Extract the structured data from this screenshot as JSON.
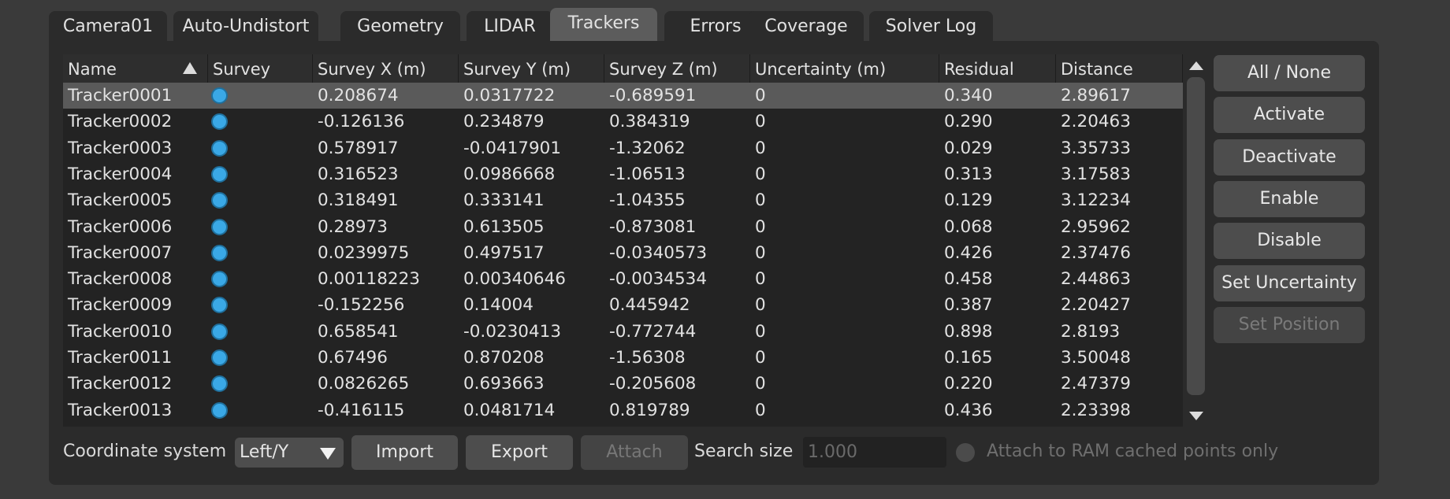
{
  "tabs": [
    {
      "label": "Camera01"
    },
    {
      "label": "Auto-Undistort"
    },
    {
      "label": "Geometry"
    },
    {
      "label": "LIDAR"
    },
    {
      "label": "Trackers",
      "active": true
    },
    {
      "label": "Errors"
    },
    {
      "label": "Coverage"
    },
    {
      "label": "Solver Log"
    }
  ],
  "table": {
    "columns": [
      "Name",
      "Survey",
      "Survey X (m)",
      "Survey Y (m)",
      "Survey Z (m)",
      "Uncertainty (m)",
      "Residual",
      "Distance"
    ],
    "sort_column": "Name",
    "sort_direction": "ascending",
    "rows": [
      {
        "name": "Tracker0001",
        "survey_x": "0.208674",
        "survey_y": "0.0317722",
        "survey_z": "-0.689591",
        "uncertainty": "0",
        "residual": "0.340",
        "distance": "2.89617",
        "selected": true
      },
      {
        "name": "Tracker0002",
        "survey_x": "-0.126136",
        "survey_y": "0.234879",
        "survey_z": "0.384319",
        "uncertainty": "0",
        "residual": "0.290",
        "distance": "2.20463"
      },
      {
        "name": "Tracker0003",
        "survey_x": "0.578917",
        "survey_y": "-0.0417901",
        "survey_z": "-1.32062",
        "uncertainty": "0",
        "residual": "0.029",
        "distance": "3.35733"
      },
      {
        "name": "Tracker0004",
        "survey_x": "0.316523",
        "survey_y": "0.0986668",
        "survey_z": "-1.06513",
        "uncertainty": "0",
        "residual": "0.313",
        "distance": "3.17583"
      },
      {
        "name": "Tracker0005",
        "survey_x": "0.318491",
        "survey_y": "0.333141",
        "survey_z": "-1.04355",
        "uncertainty": "0",
        "residual": "0.129",
        "distance": "3.12234"
      },
      {
        "name": "Tracker0006",
        "survey_x": "0.28973",
        "survey_y": "0.613505",
        "survey_z": "-0.873081",
        "uncertainty": "0",
        "residual": "0.068",
        "distance": "2.95962"
      },
      {
        "name": "Tracker0007",
        "survey_x": "0.0239975",
        "survey_y": "0.497517",
        "survey_z": "-0.0340573",
        "uncertainty": "0",
        "residual": "0.426",
        "distance": "2.37476"
      },
      {
        "name": "Tracker0008",
        "survey_x": "0.00118223",
        "survey_y": "0.00340646",
        "survey_z": "-0.0034534",
        "uncertainty": "0",
        "residual": "0.458",
        "distance": "2.44863"
      },
      {
        "name": "Tracker0009",
        "survey_x": "-0.152256",
        "survey_y": "0.14004",
        "survey_z": "0.445942",
        "uncertainty": "0",
        "residual": "0.387",
        "distance": "2.20427"
      },
      {
        "name": "Tracker0010",
        "survey_x": "0.658541",
        "survey_y": "-0.0230413",
        "survey_z": "-0.772744",
        "uncertainty": "0",
        "residual": "0.898",
        "distance": "2.8193"
      },
      {
        "name": "Tracker0011",
        "survey_x": "0.67496",
        "survey_y": "0.870208",
        "survey_z": "-1.56308",
        "uncertainty": "0",
        "residual": "0.165",
        "distance": "3.50048"
      },
      {
        "name": "Tracker0012",
        "survey_x": "0.0826265",
        "survey_y": "0.693663",
        "survey_z": "-0.205608",
        "uncertainty": "0",
        "residual": "0.220",
        "distance": "2.47379"
      },
      {
        "name": "Tracker0013",
        "survey_x": "-0.416115",
        "survey_y": "0.0481714",
        "survey_z": "0.819789",
        "uncertainty": "0",
        "residual": "0.436",
        "distance": "2.23398"
      }
    ]
  },
  "side_buttons": [
    {
      "label": "All / None",
      "enabled": true
    },
    {
      "label": "Activate",
      "enabled": true
    },
    {
      "label": "Deactivate",
      "enabled": true
    },
    {
      "label": "Enable",
      "enabled": true
    },
    {
      "label": "Disable",
      "enabled": true
    },
    {
      "label": "Set Uncertainty",
      "enabled": true
    },
    {
      "label": "Set Position",
      "enabled": false
    }
  ],
  "bottom": {
    "coordinate_system_label": "Coordinate system",
    "coordinate_system_value": "Left/Y",
    "import_label": "Import",
    "export_label": "Export",
    "attach_label": "Attach",
    "search_size_label": "Search size",
    "search_size_value": "1.000",
    "ram_cached_label": "Attach to RAM cached points only"
  },
  "colors": {
    "survey_dot": "#3aa8e6",
    "selected_row": "#5a5a5a",
    "active_tab": "#5c5c5c"
  }
}
